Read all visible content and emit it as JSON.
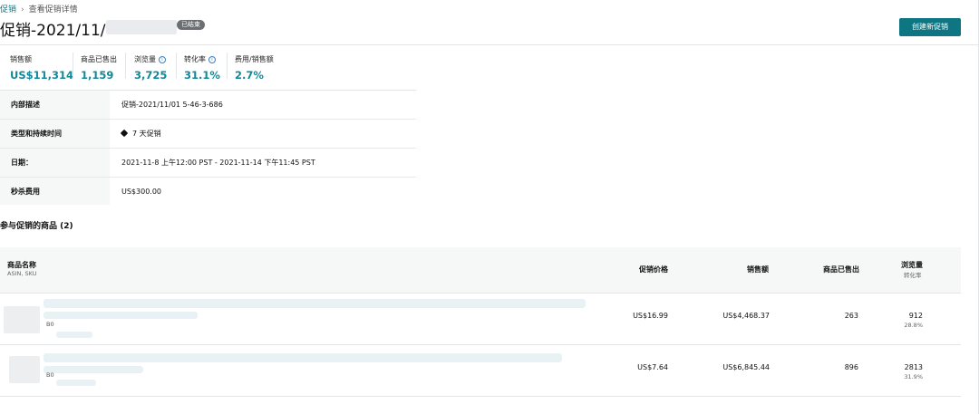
{
  "breadcrumb": {
    "parent": "促销",
    "current": "查看促销详情"
  },
  "header": {
    "title": "促销-2021/11/",
    "status_badge": "已结束",
    "create_button": "创建新促销"
  },
  "metrics": [
    {
      "label": "销售额",
      "value": "US$11,314",
      "info": false
    },
    {
      "label": "商品已售出",
      "value": "1,159",
      "info": false
    },
    {
      "label": "浏览量",
      "value": "3,725",
      "info": true
    },
    {
      "label": "转化率",
      "value": "31.1%",
      "info": true
    },
    {
      "label": "费用/销售额",
      "value": "2.7%",
      "info": false
    }
  ],
  "details": {
    "internal_desc_label": "内部描述",
    "internal_desc_value": "促销-2021/11/01 5-46-3-686",
    "type_label": "类型和持续时间",
    "type_value": "7 天促销",
    "dates_label": "日期：",
    "dates_value": "2021-11-8 上午12:00 PST - 2021-11-14 下午11:45 PST",
    "fee_label": "秒杀费用",
    "fee_value": "US$300.00"
  },
  "products_section": {
    "title": "参与促销的商品 (2)"
  },
  "table": {
    "col_name": "商品名称",
    "col_name_sub": "ASIN, SKU",
    "col_price": "促销价格",
    "col_sales": "销售额",
    "col_sold": "商品已售出",
    "col_views": "浏览量",
    "col_views_sub": "转化率",
    "rows": [
      {
        "asin": "B0",
        "price": "US$16.99",
        "sales": "US$4,468.37",
        "sold": "263",
        "views": "912",
        "conversion": "28.8%"
      },
      {
        "asin": "B0",
        "price": "US$7.64",
        "sales": "US$6,845.44",
        "sold": "896",
        "views": "2813",
        "conversion": "31.9%"
      }
    ]
  },
  "icons": {
    "info": "info-circle-icon",
    "tag": "tag-icon",
    "breadcrumb_separator": "chevron-right-icon"
  },
  "colors": {
    "accent": "#11889a",
    "button": "#0e7582",
    "badge": "#6b6f73"
  }
}
